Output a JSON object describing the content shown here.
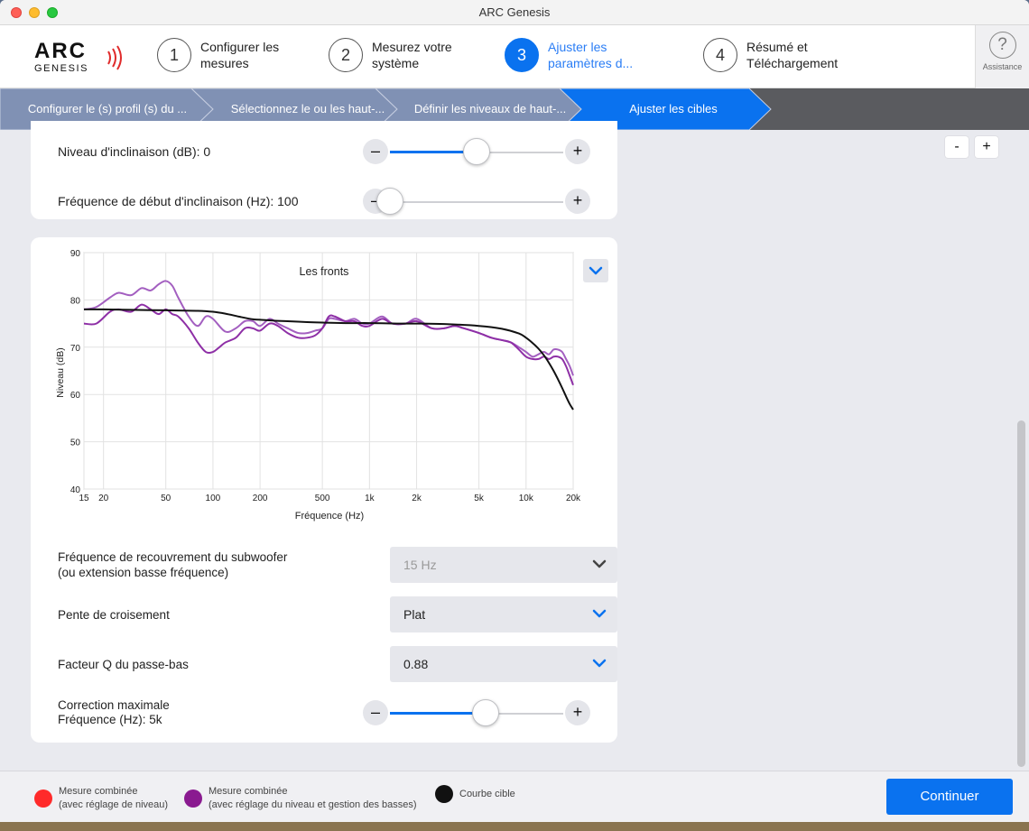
{
  "window": {
    "title": "ARC Genesis"
  },
  "logo": {
    "top": "ARC",
    "bottom": "GENESIS"
  },
  "steps": [
    {
      "num": "1",
      "label": "Configurer les mesures"
    },
    {
      "num": "2",
      "label": "Mesurez votre système"
    },
    {
      "num": "3",
      "label": "Ajuster les paramètres d...",
      "active": true
    },
    {
      "num": "4",
      "label": "Résumé et Téléchargement"
    }
  ],
  "assistance": {
    "icon": "question-icon",
    "label": "Assistance"
  },
  "breadcrumbs": [
    "Configurer le (s) profil (s) du ...",
    "Sélectionnez le ou les haut-...",
    "Définir les niveaux de haut-...",
    "Ajuster les cibles"
  ],
  "tilt": {
    "level_label": "Niveau d'inclinaison (dB): 0",
    "level_value": 0.5,
    "freq_label": "Fréquence de début d'inclinaison (Hz): 100",
    "freq_value": 0.0
  },
  "zoom": {
    "minus": "-",
    "plus": "+"
  },
  "slider_buttons": {
    "minus": "–",
    "plus": "+"
  },
  "chart_data": {
    "type": "line",
    "title": "Les fronts",
    "xlabel": "Fréquence (Hz)",
    "ylabel": "Niveau (dB)",
    "xscale": "log",
    "xlim": [
      15,
      20000
    ],
    "ylim": [
      40,
      90
    ],
    "x_ticks": [
      15,
      20,
      50,
      100,
      200,
      500,
      1000,
      2000,
      5000,
      10000,
      20000
    ],
    "x_tick_labels": [
      "15",
      "20",
      "50",
      "100",
      "200",
      "500",
      "1k",
      "2k",
      "5k",
      "10k",
      "20k"
    ],
    "y_ticks": [
      40,
      50,
      60,
      70,
      80,
      90
    ],
    "grid": true,
    "series": [
      {
        "color": "#a35fc0",
        "x": [
          15,
          18,
          22,
          25,
          30,
          35,
          40,
          45,
          50,
          55,
          60,
          70,
          80,
          90,
          100,
          120,
          140,
          160,
          180,
          200,
          230,
          260,
          300,
          350,
          400,
          450,
          500,
          550,
          600,
          700,
          800,
          900,
          1000,
          1200,
          1400,
          1700,
          2000,
          2500,
          3000,
          3500,
          4000,
          5000,
          6000,
          7000,
          8000,
          9000,
          10000,
          11000,
          12000,
          13000,
          14000,
          15000,
          16000,
          17000,
          18000,
          19000,
          20000
        ],
        "y": [
          78,
          78.5,
          80.5,
          81.5,
          81,
          82.5,
          82,
          83.3,
          84,
          83,
          80.5,
          76.5,
          74.5,
          76.5,
          76,
          73.3,
          74,
          75.5,
          75.5,
          74.5,
          76,
          75,
          74,
          73,
          73,
          73.5,
          74,
          76,
          76,
          75.5,
          76,
          75,
          75,
          76.5,
          75,
          75,
          76,
          74,
          74,
          74.5,
          74,
          73,
          72,
          71.5,
          71,
          70,
          69,
          68,
          68.5,
          69,
          68.5,
          69.5,
          69.5,
          69,
          67.5,
          66,
          64
        ]
      },
      {
        "color": "#8e2fa6",
        "x": [
          15,
          18,
          22,
          25,
          30,
          35,
          40,
          45,
          50,
          55,
          60,
          70,
          80,
          90,
          100,
          110,
          120,
          140,
          160,
          180,
          200,
          230,
          260,
          300,
          350,
          400,
          450,
          500,
          550,
          600,
          700,
          800,
          900,
          1000,
          1200,
          1400,
          1700,
          2000,
          2500,
          3000,
          3500,
          4000,
          5000,
          6000,
          7000,
          8000,
          9000,
          10000,
          11000,
          12000,
          13000,
          14000,
          15000,
          16000,
          17000,
          18000,
          19000,
          20000
        ],
        "y": [
          75,
          75,
          77.5,
          78,
          77.5,
          79,
          78,
          77,
          78,
          77,
          76.5,
          74,
          71,
          69,
          69,
          70,
          71,
          72,
          74,
          74,
          73.5,
          75,
          74.5,
          73,
          72,
          72,
          72.5,
          74,
          76.5,
          76.5,
          75.5,
          75.5,
          74.5,
          74.5,
          76,
          75,
          75,
          75.5,
          74,
          74,
          74.5,
          74,
          73,
          72,
          71.5,
          71,
          69.5,
          68,
          67.5,
          67.5,
          68,
          67.5,
          68,
          68,
          67.5,
          66,
          64,
          62
        ]
      },
      {
        "color": "#111111",
        "x": [
          15,
          20,
          30,
          50,
          80,
          100,
          120,
          150,
          180,
          200,
          250,
          300,
          400,
          500,
          700,
          1000,
          1500,
          2000,
          3000,
          5000,
          7000,
          9000,
          10000,
          11000,
          12000,
          13000,
          14000,
          15000,
          16000,
          17000,
          18000,
          19000,
          20000
        ],
        "y": [
          78,
          78,
          77.9,
          77.8,
          77.7,
          77.5,
          77.1,
          76.4,
          75.9,
          75.8,
          75.6,
          75.5,
          75.3,
          75.2,
          75.1,
          75.1,
          75.0,
          75.0,
          74.9,
          74.5,
          73.9,
          72.9,
          72.0,
          70.9,
          69.7,
          68.3,
          66.7,
          65.0,
          63.2,
          61.4,
          59.6,
          58.0,
          56.8
        ]
      }
    ]
  },
  "chart_toggle": {
    "icon": "chevron-down-icon"
  },
  "form": {
    "crossover_label": "Fréquence de recouvrement du subwoofer\n(ou extension basse fréquence)",
    "crossover_value": "15 Hz",
    "slope_label": "Pente de croisement",
    "slope_value": "Plat",
    "q_label": "Facteur Q du passe-bas",
    "q_value": "0.88",
    "maxcorr_label": "Correction maximale\nFréquence (Hz): 5k",
    "maxcorr_value": 0.55
  },
  "legend": [
    {
      "color": "#ff2a2a",
      "text": "Mesure combinée\n(avec réglage de niveau)"
    },
    {
      "color": "#8a1a90",
      "text": "Mesure combinée\n(avec réglage du niveau et gestion des basses)"
    },
    {
      "color": "#111111",
      "text": "Courbe cible"
    }
  ],
  "footer": {
    "continue": "Continuer"
  }
}
